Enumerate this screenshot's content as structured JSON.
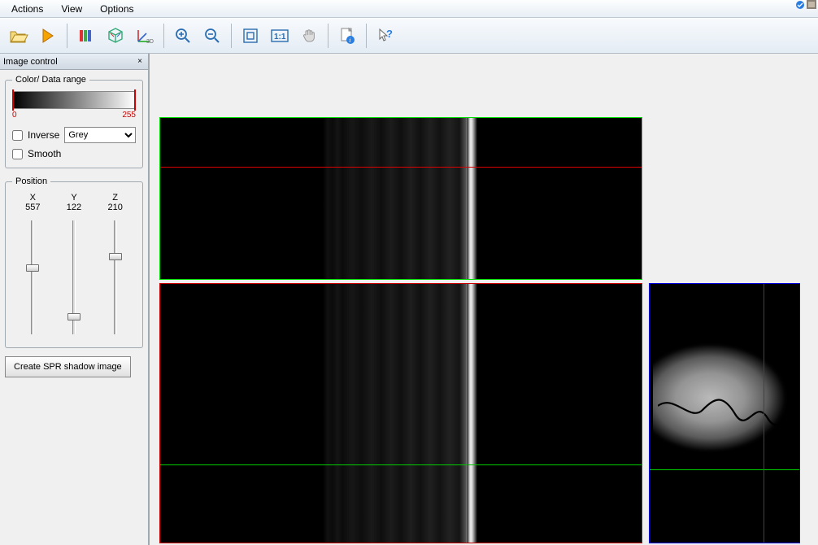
{
  "menu": {
    "actions": "Actions",
    "view": "View",
    "options": "Options"
  },
  "sidebar": {
    "title": "Image control",
    "color_range_legend": "Color/ Data range",
    "grad_min": "0",
    "grad_max": "255",
    "inverse_label": "Inverse",
    "colormap_selected": "Grey",
    "smooth_label": "Smooth",
    "position_legend": "Position",
    "axis_x": "X",
    "axis_y": "Y",
    "axis_z": "Z",
    "val_x": "557",
    "val_y": "122",
    "val_z": "210",
    "create_spr_btn": "Create SPR shadow image"
  },
  "toolbar": {
    "open": "open-file",
    "run": "run",
    "stack": "color-stack",
    "cube3d": "render-3d",
    "xyz": "xyz-axes",
    "zoomin": "zoom-in",
    "zoomout": "zoom-out",
    "fit": "fit-to-window",
    "oneone": "actual-size",
    "pan": "pan-hand",
    "info": "page-info",
    "help": "pointer-help"
  }
}
